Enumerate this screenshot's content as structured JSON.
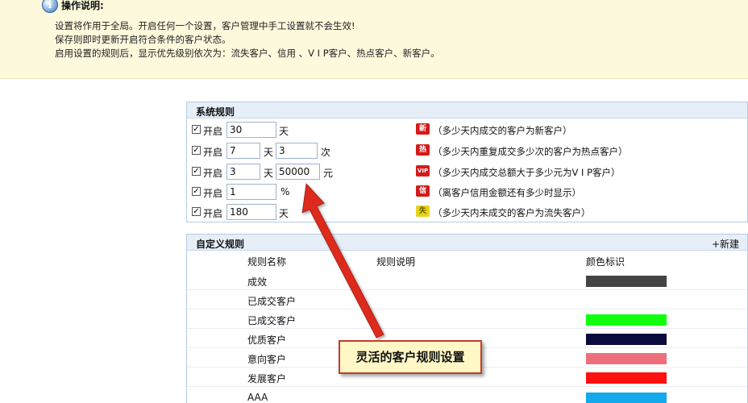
{
  "info": {
    "title": "操作说明:",
    "lines": [
      "设置将作用于全局。开启任何一个设置，客户管理中手工设置就不会生效!",
      "保存则即时更新开启符合条件的客户状态。",
      "启用设置的规则后，显示优先级别依次为：流失客户、信用 、V I P客户、热点客户、新客户。"
    ]
  },
  "system_rules": {
    "title": "系统规则",
    "enable_label": "开启",
    "rows": [
      {
        "checked": "✓",
        "v1": "30",
        "u1": "天",
        "v2": "",
        "u2": "",
        "badge": "新",
        "desc": "（多少天内成交的客户为新客户）"
      },
      {
        "checked": "✓",
        "v1": "7",
        "u1": "天",
        "v2": "3",
        "u2": "次",
        "badge": "热",
        "desc": "（多少天内重复成交多少次的客户为热点客户）"
      },
      {
        "checked": "✓",
        "v1": "3",
        "u1": "天",
        "v2": "50000",
        "u2": "元",
        "badge": "VIP",
        "desc": "（多少天内成交总额大于多少元为V I P客户）"
      },
      {
        "checked": "✓",
        "v1": "1",
        "u1": "%",
        "v2": "",
        "u2": "",
        "badge": "信",
        "desc": "（离客户信用金额还有多少时显示）"
      },
      {
        "checked": "✓",
        "v1": "180",
        "u1": "天",
        "v2": "",
        "u2": "",
        "badge": "失",
        "desc": "（多少天内未成交的客户为流失客户）"
      }
    ]
  },
  "custom_rules": {
    "title": "自定义规则",
    "new_label": "+新建",
    "columns": {
      "name": "规则名称",
      "desc": "规则说明",
      "color": "颜色标识"
    },
    "rows": [
      {
        "name": "成效",
        "color": "#444444"
      },
      {
        "name": "已成交客户",
        "color": ""
      },
      {
        "name": "已成交客户",
        "color": "#11ff11"
      },
      {
        "name": "优质客户",
        "color": "#0a0a3c"
      },
      {
        "name": "意向客户",
        "color": "#ee6f7c"
      },
      {
        "name": "发展客户",
        "color": "#ff0f0f"
      },
      {
        "name": "AAA",
        "color": "#13a9ea"
      }
    ]
  },
  "annotation": {
    "text": "灵活的客户规则设置"
  }
}
